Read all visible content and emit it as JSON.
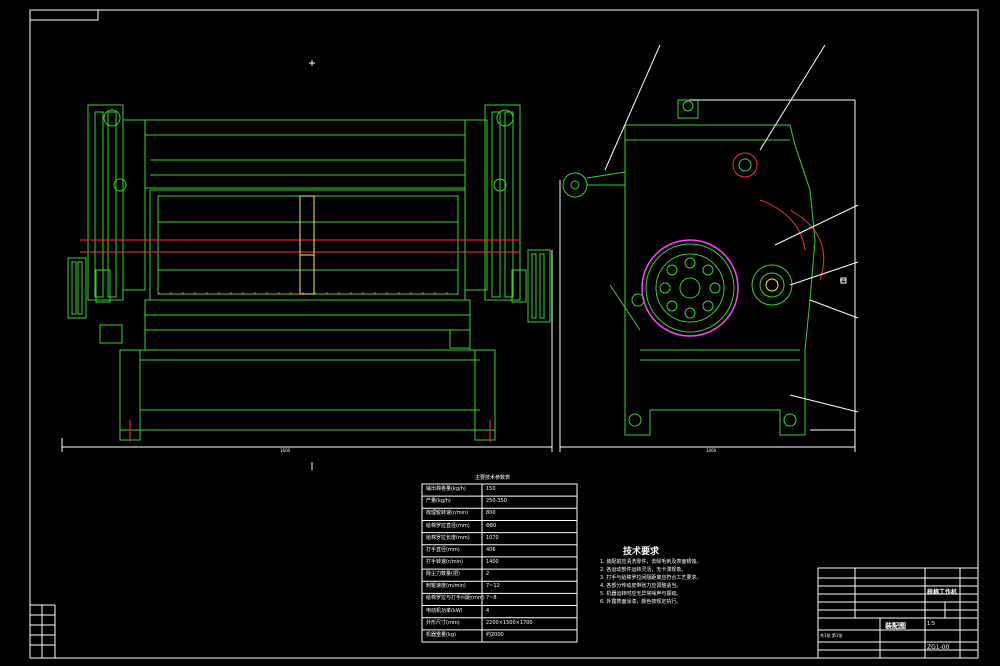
{
  "drawing": {
    "param_table": {
      "title": "主要技术参数表",
      "rows": [
        {
          "name": "输出棉卷量(kg/h)",
          "value": "150"
        },
        {
          "name": "产量(kg/h)",
          "value": "250-350"
        },
        {
          "name": "梳理辊转速(r/min)",
          "value": "800"
        },
        {
          "name": "给棉罗拉直径(mm)",
          "value": "Φ80"
        },
        {
          "name": "给棉罗拉长度(mm)",
          "value": "1070"
        },
        {
          "name": "打手直径(mm)",
          "value": "406"
        },
        {
          "name": "打手转速(r/min)",
          "value": "1400"
        },
        {
          "name": "除尘刀数量(把)",
          "value": "2"
        },
        {
          "name": "刺辊速度(m/min)",
          "value": "7~12"
        },
        {
          "name": "给棉罗拉与打手间距(mm)",
          "value": "7~8"
        },
        {
          "name": "电动机功率(kW)",
          "value": "4"
        },
        {
          "name": "外形尺寸(mm)",
          "value": "2200×1500×1700"
        },
        {
          "name": "机器重量(kg)",
          "value": "约2000"
        }
      ]
    },
    "notes": {
      "title": "技术要求",
      "lines": [
        "1. 装配前应清洗零件，去除毛刺及表面锈蚀。",
        "2. 各运动部件运转灵活，无卡滞现象。",
        "3. 打手与给棉罗拉间隔距离应符合工艺要求。",
        "4. 各部分传动皮带张力应调整适当。",
        "5. 机器运转时应无异常噪声与振动。",
        "6. 外露表面涂漆，颜色按规定执行。"
      ]
    },
    "title_block": {
      "title": "梳棉工作机",
      "drawing_no": "ZG1-00",
      "assembly": "装配图",
      "scale": "1:5",
      "sheet": "共1张 第1张"
    },
    "dims": {
      "front_width": "1600",
      "side_width": "1000"
    }
  }
}
